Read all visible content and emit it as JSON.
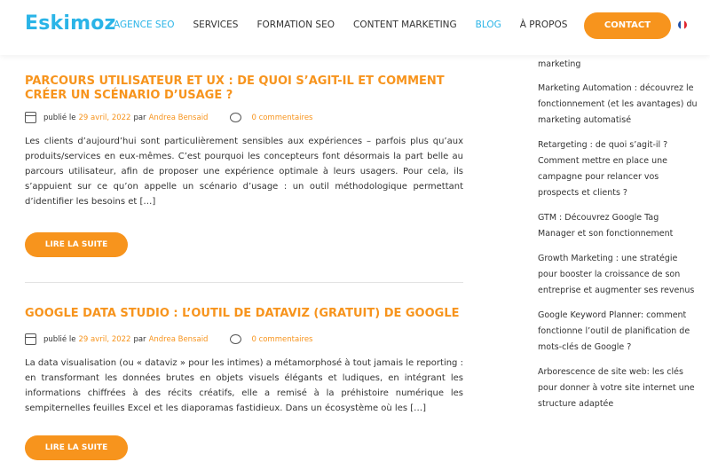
{
  "header": {
    "logo": "Eskimoz",
    "nav": [
      {
        "label": "AGENCE SEO",
        "active": true
      },
      {
        "label": "SERVICES",
        "active": false
      },
      {
        "label": "FORMATION SEO",
        "active": false
      },
      {
        "label": "CONTENT MARKETING",
        "active": false
      },
      {
        "label": "BLOG",
        "active": true
      },
      {
        "label": "À PROPOS",
        "active": false
      }
    ],
    "contact_label": "CONTACT",
    "flag_icon": "france-flag-icon"
  },
  "articles": [
    {
      "title": "PARCOURS UTILISATEUR ET UX : DE QUOI S’AGIT-IL ET COMMENT CRÉER UN SCÉNARIO D’USAGE ?",
      "published_prefix": "publié le",
      "date": "29 avril, 2022",
      "by": "par",
      "author": "Andrea Bensaid",
      "comments": "0 commentaires",
      "excerpt": "Les clients d’aujourd’hui sont particulièrement sensibles aux expériences – parfois plus qu’aux produits/services en eux-mêmes. C’est pourquoi les concepteurs font désormais la part belle au parcours utilisateur, afin de proposer une expérience optimale à leurs usagers. Pour cela, ils s’appuient sur ce qu’on appelle un scénario d’usage : un outil méthodologique permettant d’identifier les besoins et […]",
      "read_more": "LIRE LA SUITE"
    },
    {
      "title": "GOOGLE DATA STUDIO : L’OUTIL DE DATAVIZ (GRATUIT) DE GOOGLE",
      "published_prefix": "publié le",
      "date": "29 avril, 2022",
      "by": "par",
      "author": "Andrea Bensaid",
      "comments": "0 commentaires",
      "excerpt": "La data visualisation (ou « dataviz » pour les intimes) a métamorphosé à tout jamais le reporting : en transformant les données brutes en objets visuels élégants et ludiques, en intégrant les informations chiffrées à des récits créatifs, elle a remisé à la préhistoire numérique les sempiternelles feuilles Excel et les diaporamas fastidieux. Dans un écosystème où les […]",
      "read_more": "LIRE LA SUITE"
    }
  ],
  "sidebar": {
    "items": [
      "marketing",
      "Marketing Automation : découvrez le fonctionnement (et les avantages) du marketing automatisé",
      "Retargeting : de quoi s’agit-il ? Comment mettre en place une campagne pour relancer vos prospects et clients ?",
      "GTM : Découvrez Google Tag Manager et son fonctionnement",
      "Growth Marketing : une stratégie pour booster la croissance de son entreprise et augmenter ses revenus",
      "Google Keyword Planner: comment fonctionne l’outil de planification de mots-clés de Google ?",
      "Arborescence de site web: les clés pour donner à votre site internet une structure adaptée"
    ]
  },
  "colors": {
    "brand_blue": "#2ab4e7",
    "accent_orange": "#f7941d"
  }
}
